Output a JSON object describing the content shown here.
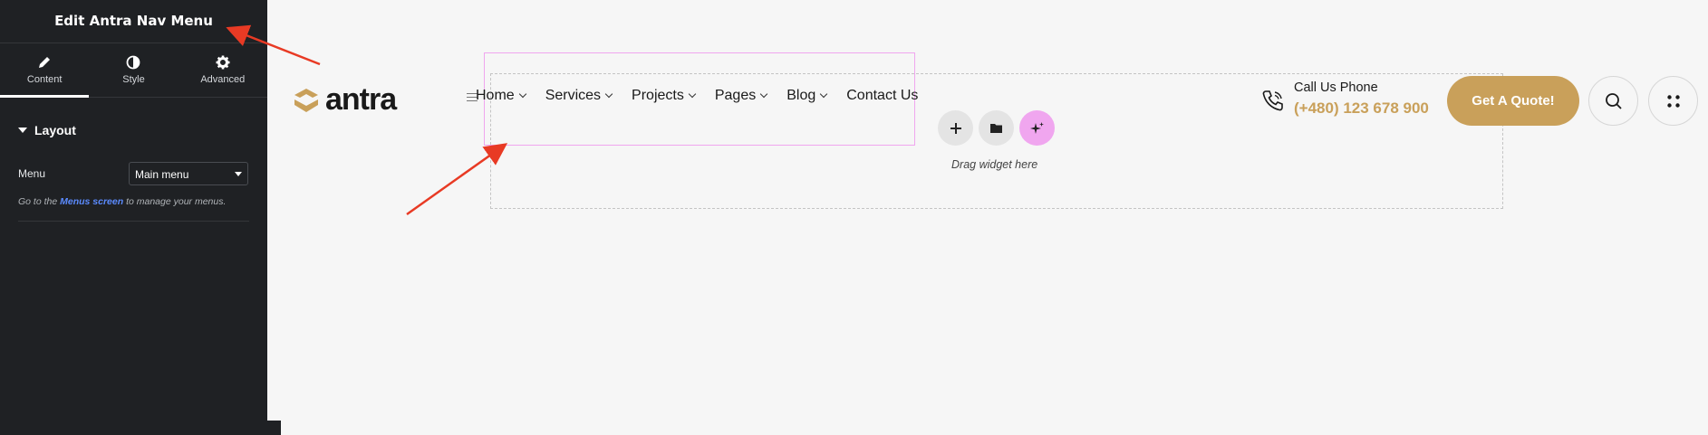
{
  "panel": {
    "title": "Edit Antra Nav Menu",
    "tabs": [
      {
        "label": "Content",
        "icon": "pencil-icon",
        "active": true
      },
      {
        "label": "Style",
        "icon": "half-circle-icon",
        "active": false
      },
      {
        "label": "Advanced",
        "icon": "gear-icon",
        "active": false
      }
    ],
    "section_title": "Layout",
    "menu_label": "Menu",
    "menu_value": "Main menu",
    "hint_prefix": "Go to the ",
    "hint_link": "Menus screen",
    "hint_suffix": " to manage your menus."
  },
  "site": {
    "logo_text": "antra",
    "brand_color": "#c9a05a",
    "nav": [
      "Home",
      "Services",
      "Projects",
      "Pages",
      "Blog",
      "Contact Us"
    ],
    "drag_text": "Drag widget here",
    "call_label": "Call Us Phone",
    "call_number": "(+480) 123 678 900",
    "quote_label": "Get A Quote!"
  },
  "colors": {
    "panel_bg": "#1f2124",
    "selection_border": "#f0a6ef",
    "annotation_arrow": "#e83a24"
  }
}
